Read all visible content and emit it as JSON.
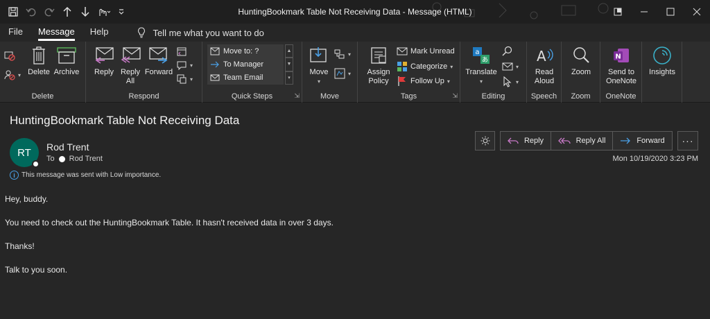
{
  "window": {
    "title": "HuntingBookmark Table Not Receiving Data  -  Message (HTML)"
  },
  "qat": {
    "icons": [
      "save-icon",
      "undo-icon",
      "redo-icon",
      "up-arrow-icon",
      "down-arrow-icon",
      "touch-mode-icon",
      "customize-icon"
    ]
  },
  "tabs": [
    {
      "label": "File"
    },
    {
      "label": "Message"
    },
    {
      "label": "Help"
    }
  ],
  "tellme": {
    "label": "Tell me what you want to do"
  },
  "ribbon": {
    "delete_group": {
      "label": "Delete",
      "delete": "Delete",
      "archive": "Archive"
    },
    "respond_group": {
      "label": "Respond",
      "reply": "Reply",
      "reply_all_1": "Reply",
      "reply_all_2": "All",
      "forward": "Forward"
    },
    "quicksteps_group": {
      "label": "Quick Steps",
      "items": [
        "Move to: ?",
        "To Manager",
        "Team Email"
      ]
    },
    "move_group": {
      "label": "Move",
      "move": "Move"
    },
    "tags_group": {
      "label": "Tags",
      "assign_1": "Assign",
      "assign_2": "Policy",
      "mark_unread": "Mark Unread",
      "categorize": "Categorize",
      "follow_up": "Follow Up"
    },
    "editing_group": {
      "label": "Editing",
      "translate": "Translate"
    },
    "speech_group": {
      "label": "Speech",
      "read_1": "Read",
      "read_2": "Aloud"
    },
    "zoom_group": {
      "label": "Zoom",
      "zoom": "Zoom"
    },
    "onenote_group": {
      "label": "OneNote",
      "send_1": "Send to",
      "send_2": "OneNote"
    },
    "insights": {
      "label": "Insights"
    }
  },
  "message": {
    "subject": "HuntingBookmark Table Not Receiving Data",
    "avatar_initials": "RT",
    "sender": "Rod Trent",
    "to_label": "To",
    "recipient": "Rod Trent",
    "importance": "This message was sent with Low importance.",
    "timestamp": "Mon 10/19/2020 3:23 PM",
    "actions": {
      "reply": "Reply",
      "reply_all": "Reply All",
      "forward": "Forward"
    },
    "body": [
      "Hey, buddy.",
      "You need to check out the HuntingBookmark Table. It hasn't received data in over 3 days.",
      "Thanks!",
      "Talk to you soon."
    ]
  }
}
